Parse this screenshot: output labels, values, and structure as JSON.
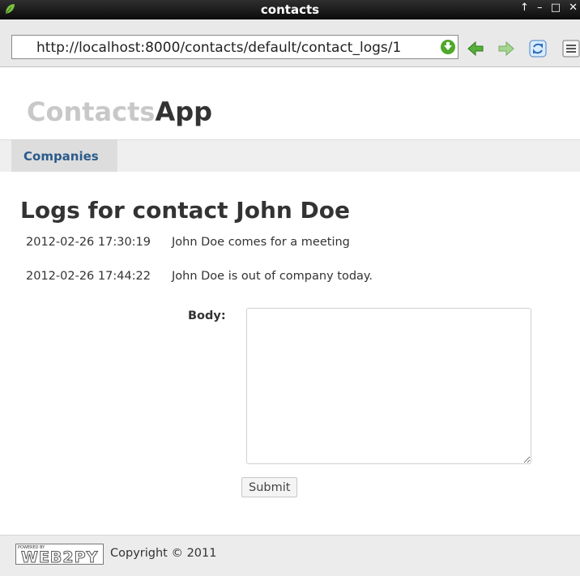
{
  "window": {
    "title": "contacts",
    "controls": "↑ – □ ✕",
    "app_icon": "leaf-icon"
  },
  "toolbar": {
    "url": "http://localhost:8000/contacts/default/contact_logs/1",
    "icons": [
      "go-arrow-icon",
      "back-arrow-icon",
      "forward-arrow-icon",
      "reload-icon",
      "menu-icon"
    ]
  },
  "brand": {
    "light": "Contacts",
    "dark": "App"
  },
  "menu": {
    "items": [
      {
        "label": "Companies"
      }
    ]
  },
  "main": {
    "heading": "Logs for contact John Doe",
    "logs": [
      {
        "timestamp": "2012-02-26 17:30:19",
        "text": "John Doe comes for a meeting"
      },
      {
        "timestamp": "2012-02-26 17:44:22",
        "text": "John Doe is out of company today."
      }
    ],
    "form": {
      "body_label": "Body:",
      "body_value": "",
      "submit_label": "Submit"
    }
  },
  "footer": {
    "badge_small": "POWERED BY",
    "badge_logo": "WEB2PY",
    "copyright": "Copyright © 2011"
  },
  "colors": {
    "menu_link": "#2b5b8c",
    "brand_light": "#c8c8c8",
    "brand_dark": "#333333"
  }
}
